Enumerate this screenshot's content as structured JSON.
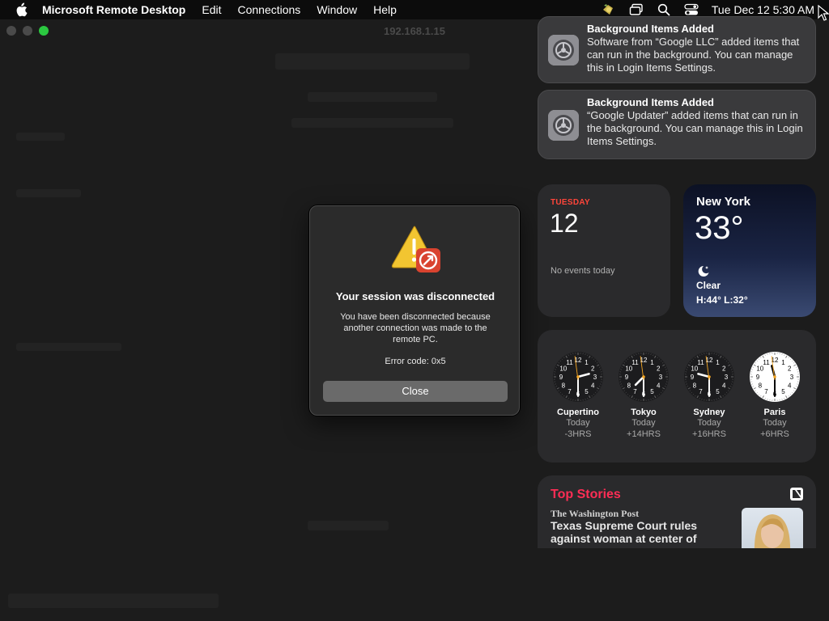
{
  "menubar": {
    "app_name": "Microsoft Remote Desktop",
    "menus": [
      "Edit",
      "Connections",
      "Window",
      "Help"
    ],
    "datetime": "Tue Dec 12  5:30 AM",
    "status_icons": [
      "app-extension-icon",
      "screen-mirror-icon",
      "search-icon",
      "control-center-icon"
    ]
  },
  "window": {
    "title": "192.168.1.15"
  },
  "dialog": {
    "title": "Your session was disconnected",
    "message": "You have been disconnected because another connection was made to the remote PC.",
    "error_code": "Error code: 0x5",
    "close_label": "Close"
  },
  "notifications": [
    {
      "title": "Background Items Added",
      "body": "Software from “Google LLC” added items that can run in the background. You can manage this in Login Items Settings."
    },
    {
      "title": "Background Items Added",
      "body": "“Google Updater” added items that can run in the background. You can manage this in Login Items Settings."
    }
  ],
  "calendar": {
    "weekday": "TUESDAY",
    "day": "12",
    "events": "No events today"
  },
  "weather": {
    "city": "New York",
    "temp": "33°",
    "condition": "Clear",
    "high_low": "H:44° L:32°",
    "icon": "moon-icon"
  },
  "world_clocks": [
    {
      "city": "Cupertino",
      "day": "Today",
      "offset": "-3HRS",
      "hour": 2,
      "minute": 30,
      "theme": "dark"
    },
    {
      "city": "Tokyo",
      "day": "Today",
      "offset": "+14HRS",
      "hour": 7,
      "minute": 30,
      "theme": "dark"
    },
    {
      "city": "Sydney",
      "day": "Today",
      "offset": "+16HRS",
      "hour": 9,
      "minute": 30,
      "theme": "dark"
    },
    {
      "city": "Paris",
      "day": "Today",
      "offset": "+6HRS",
      "hour": 11,
      "minute": 30,
      "theme": "light"
    }
  ],
  "news": {
    "header": "Top Stories",
    "source": "The Washington Post",
    "headline": "Texas Supreme Court rules against woman at center of"
  },
  "colors": {
    "accent_red": "#ff453a",
    "news_pink": "#ff2d55",
    "maximize_green": "#2bc840",
    "clock_second_hand": "#f5a623"
  }
}
